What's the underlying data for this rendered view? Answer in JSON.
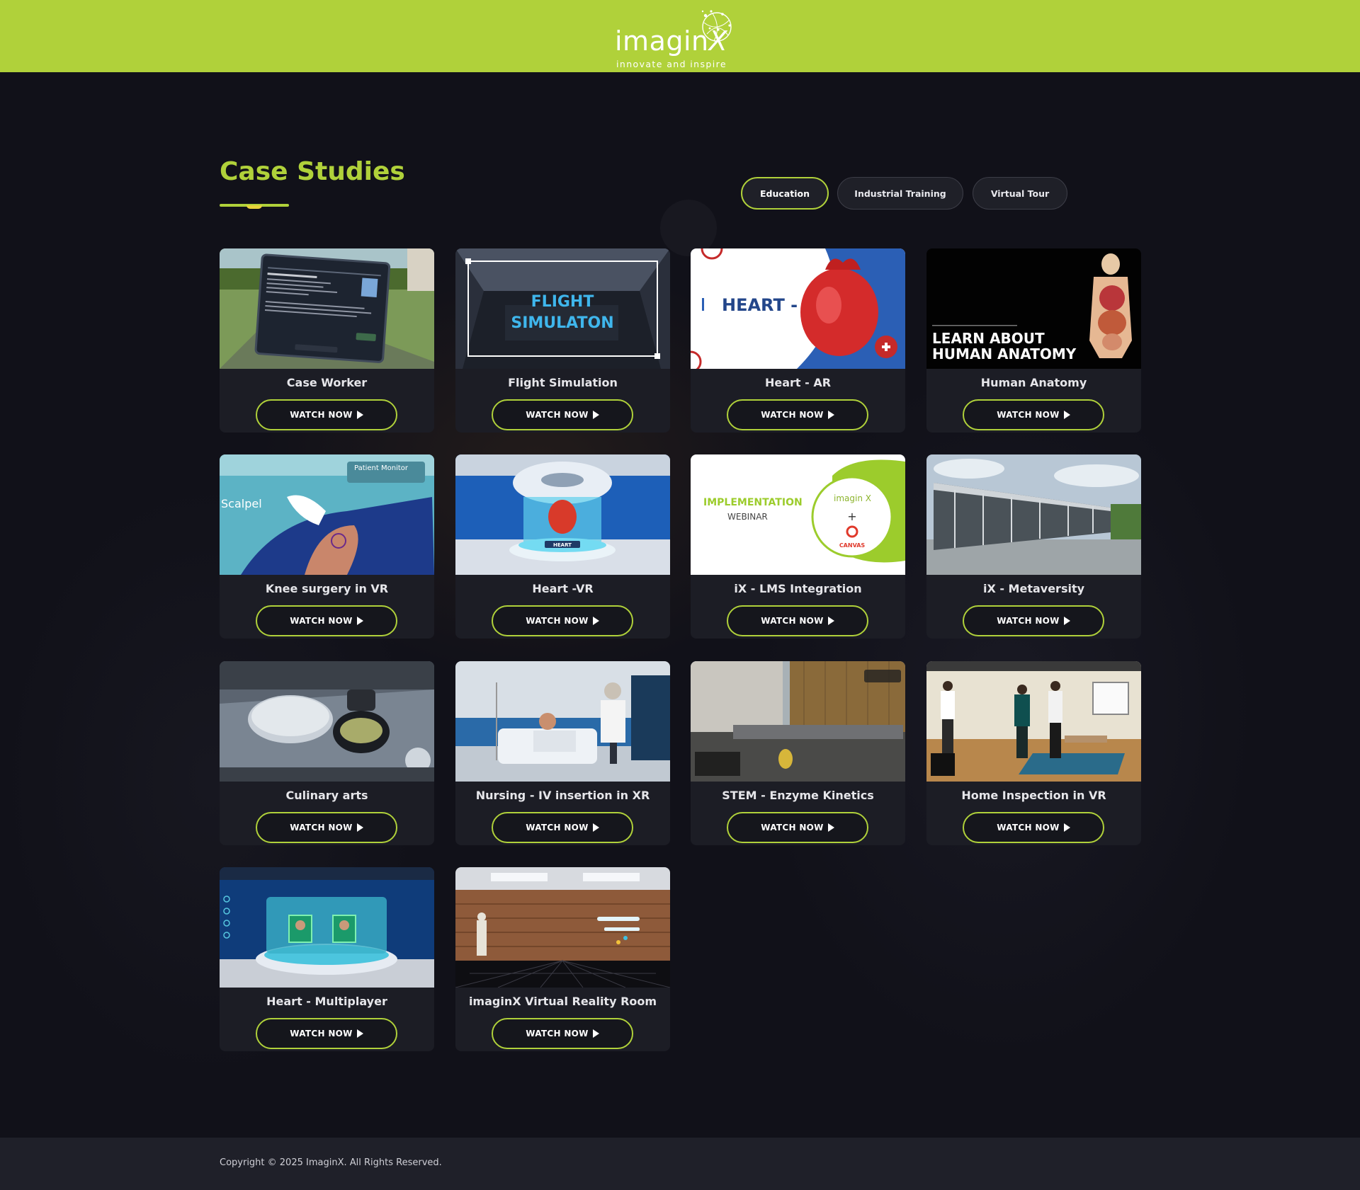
{
  "header": {
    "logo_word": "imagin",
    "logo_x": "X",
    "logo_tagline": "innovate and inspire"
  },
  "section": {
    "title": "Case Studies"
  },
  "filters": [
    {
      "label": "Education",
      "active": true
    },
    {
      "label": "Industrial Training",
      "active": false
    },
    {
      "label": "Virtual Tour",
      "active": false
    }
  ],
  "watch_label": "WATCH NOW",
  "cards": [
    {
      "title": "Case Worker"
    },
    {
      "title": "Flight Simulation",
      "thumb_text": [
        "FLIGHT",
        "SIMULATON"
      ]
    },
    {
      "title": "Heart - AR",
      "thumb_text": [
        "HEART - AR"
      ]
    },
    {
      "title": "Human Anatomy",
      "thumb_text": [
        "LEARN ABOUT",
        "HUMAN ANATOMY"
      ]
    },
    {
      "title": "Knee surgery in VR",
      "thumb_text": [
        "Scalpel",
        "Patient Monitor"
      ]
    },
    {
      "title": "Heart -VR",
      "thumb_text": [
        "HEART"
      ]
    },
    {
      "title": "iX - LMS Integration",
      "thumb_text": [
        "IMPLEMENTATION",
        "WEBINAR",
        "imagin X",
        "+",
        "CANVAS"
      ]
    },
    {
      "title": "iX - Metaversity"
    },
    {
      "title": "Culinary arts"
    },
    {
      "title": "Nursing - IV insertion in XR"
    },
    {
      "title": "STEM - Enzyme Kinetics"
    },
    {
      "title": "Home Inspection in VR"
    },
    {
      "title": "Heart - Multiplayer"
    },
    {
      "title": "imaginX Virtual Reality Room"
    }
  ],
  "footer": {
    "copyright": "Copyright © 2025 ImaginX. All Rights Reserved."
  },
  "colors": {
    "brand_green": "#b0d13a",
    "background": "#111119",
    "card": "#1c1d25",
    "footer": "#1f2029"
  }
}
